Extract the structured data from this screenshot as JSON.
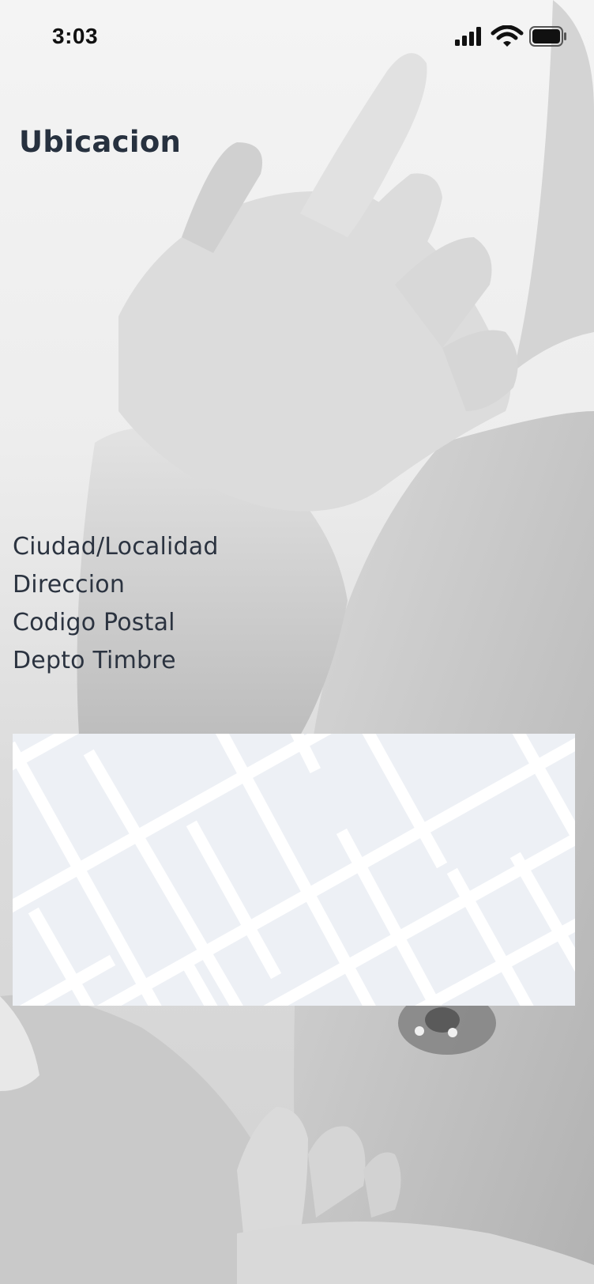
{
  "status_bar": {
    "time": "3:03"
  },
  "header": {
    "title": "Ubicacion"
  },
  "fields": {
    "items": [
      {
        "label": "Ciudad/Localidad"
      },
      {
        "label": "Direccion"
      },
      {
        "label": "Codigo Postal"
      },
      {
        "label": "Depto Timbre"
      }
    ]
  },
  "map": {
    "background_color": "#edf0f5",
    "street_color": "#ffffff"
  },
  "icons": {
    "signal": "cellular-signal-icon",
    "wifi": "wifi-icon",
    "battery": "battery-icon"
  }
}
